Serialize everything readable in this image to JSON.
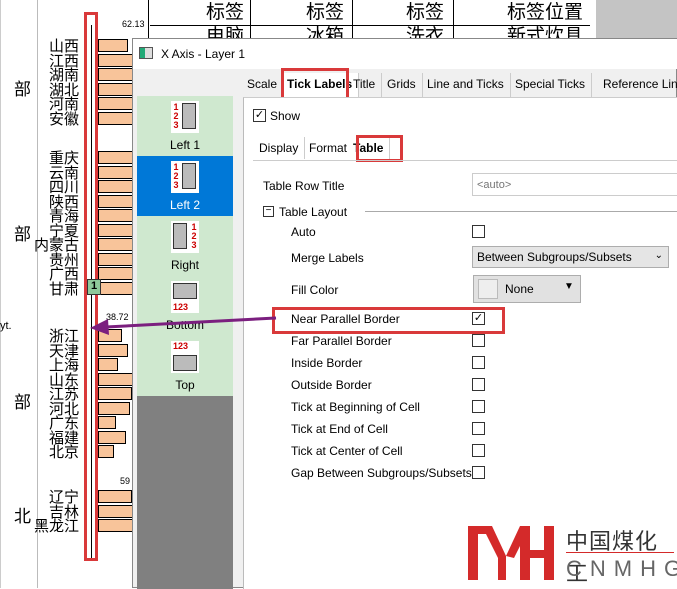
{
  "chart": {
    "column_headers": [
      {
        "top": "标签",
        "bottom": "电脑"
      },
      {
        "top": "标签",
        "bottom": "冰箱"
      },
      {
        "top": "标签",
        "bottom": "洗衣"
      },
      {
        "top": "标签位置",
        "bottom": "新式炊具"
      }
    ],
    "value_labels": [
      "62.13",
      "38.72",
      "59"
    ],
    "side_label": "yt.",
    "groups": [
      {
        "label": "部",
        "provinces": [
          "山西",
          "江西",
          "湖南",
          "湖北",
          "河南",
          "安徽"
        ],
        "values": [
          0.75,
          1,
          1,
          1,
          1,
          1
        ]
      },
      {
        "label": "部",
        "provinces": [
          "重庆",
          "云南",
          "四川",
          "陕西",
          "青海",
          "宁夏",
          "内蒙古",
          "贵州",
          "广西",
          "甘肃"
        ],
        "values": [
          1,
          1,
          1,
          1,
          0.9,
          1,
          1,
          1,
          1,
          1
        ]
      },
      {
        "label": "部",
        "provinces": [
          "浙江",
          "天津",
          "上海",
          "山东",
          "江苏",
          "河北",
          "广东",
          "福建",
          "北京"
        ],
        "values": [
          0.6,
          0.75,
          0.5,
          1,
          0.85,
          0.8,
          0.45,
          0.7,
          0.4
        ]
      },
      {
        "label": "北",
        "provinces": [
          "辽宁",
          "吉林",
          "黑龙江"
        ],
        "values": [
          0.85,
          1,
          1
        ]
      }
    ],
    "layer_marker": "1",
    "bar_color": "#f8c49a",
    "highlight_color": "#d9393a",
    "arrow_color": "#7b1f7f"
  },
  "dialog": {
    "title": "X Axis - Layer 1",
    "tabs": [
      "Scale",
      "Tick Labels",
      "Title",
      "Grids",
      "Line and Ticks",
      "Special Ticks",
      "Reference Line"
    ],
    "active_tab": "Tick Labels",
    "side_items": [
      {
        "label": "Left 1",
        "glyph": "123"
      },
      {
        "label": "Left 2",
        "glyph": "123"
      },
      {
        "label": "Right",
        "glyph": "123"
      },
      {
        "label": "Bottom",
        "glyph": "123"
      },
      {
        "label": "Top",
        "glyph": "123"
      }
    ],
    "selected_side": "Left 2",
    "show_label": "Show",
    "show_checked": true,
    "subtabs": [
      "Display",
      "Format",
      "Table"
    ],
    "active_subtab": "Table",
    "table_row_title_label": "Table Row Title",
    "table_row_title_placeholder": "<auto>",
    "table_layout_label": "Table Layout",
    "auto_label": "Auto",
    "merge_labels_label": "Merge Labels",
    "merge_labels_value": "Between Subgroups/Subsets",
    "fill_color_label": "Fill Color",
    "fill_color_value": "None",
    "options": [
      {
        "label": "Near Parallel Border",
        "checked": true
      },
      {
        "label": "Far Parallel Border",
        "checked": false
      },
      {
        "label": "Inside Border",
        "checked": false
      },
      {
        "label": "Outside Border",
        "checked": false
      },
      {
        "label": "Tick at Beginning of Cell",
        "checked": false
      },
      {
        "label": "Tick at End of Cell",
        "checked": false
      },
      {
        "label": "Tick at Center of Cell",
        "checked": false
      },
      {
        "label": "Gap Between Subgroups/Subsets",
        "checked": false
      }
    ]
  },
  "watermark": {
    "cn": "中国煤化工",
    "en": "CNMHG"
  }
}
